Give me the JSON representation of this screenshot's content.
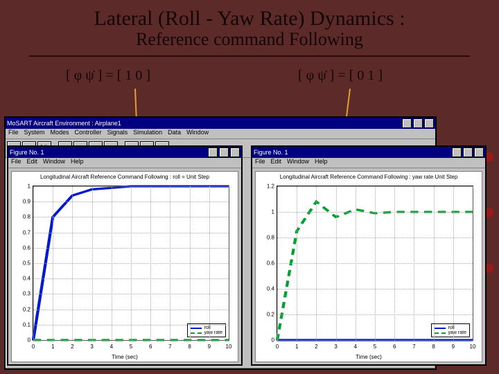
{
  "title": {
    "main": "Lateral (Roll - Yaw Rate) Dynamics :",
    "sub": "Reference command Following"
  },
  "equations": {
    "left": "[ φ  ψ̇ ]  =  [ 1  0 ]",
    "right": "[ φ  ψ̇ ]  =  [ 0  1 ]"
  },
  "sim_window": {
    "title": "MoSART Aircraft Environment : Airplane1",
    "menus": [
      "File",
      "System",
      "Modes",
      "Controller",
      "Signals",
      "Simulation",
      "Data",
      "Window"
    ],
    "tool_icons": [
      "new-icon",
      "open-icon",
      "save-icon",
      "run-icon",
      "pause-icon",
      "stop-icon",
      "step-icon",
      "plot-icon",
      "scope-icon",
      "config-icon"
    ]
  },
  "fig_left": {
    "title": "Figure No. 1",
    "menus": [
      "File",
      "Edit",
      "Window",
      "Help"
    ],
    "plot_title": "Longitudinal Aircraft Reference Command Following : roll = Unit Step",
    "xlabel": "Time (sec)",
    "legend": {
      "s1": "roll",
      "s2": "yaw rate"
    }
  },
  "fig_right": {
    "title": "Figure No. 1",
    "menus": [
      "File",
      "Edit",
      "Window",
      "Help"
    ],
    "plot_title": "Longitudinal Aircraft Reference Command Following : yaw rate  Unit Step",
    "xlabel": "Time (sec)",
    "legend": {
      "s1": "roll",
      "s2": "yaw rate"
    }
  },
  "chart_data": [
    {
      "type": "line",
      "title": "Longitudinal Aircraft Reference Command Following : roll = Unit Step",
      "xlabel": "Time (sec)",
      "ylabel": "",
      "xlim": [
        0,
        10
      ],
      "ylim": [
        0,
        1
      ],
      "grid": true,
      "legend_position": "bottom-right",
      "x": [
        0,
        1,
        2,
        3,
        4,
        5,
        6,
        7,
        8,
        9,
        10
      ],
      "series": [
        {
          "name": "roll",
          "color": "#0018d0",
          "dash": "solid",
          "values": [
            0.0,
            0.8,
            0.94,
            0.98,
            0.99,
            1.0,
            1.0,
            1.0,
            1.0,
            1.0,
            1.0
          ]
        },
        {
          "name": "yaw rate",
          "color": "#00a030",
          "dash": "dash",
          "values": [
            0.0,
            0.0,
            0.0,
            0.0,
            0.0,
            0.0,
            0.0,
            0.0,
            0.0,
            0.0,
            0.0
          ]
        }
      ],
      "xticks": [
        0,
        1,
        2,
        3,
        4,
        5,
        6,
        7,
        8,
        9,
        10
      ],
      "yticks": [
        0,
        0.1,
        0.2,
        0.3,
        0.4,
        0.5,
        0.6,
        0.7,
        0.8,
        0.9,
        1
      ]
    },
    {
      "type": "line",
      "title": "Longitudinal Aircraft Reference Command Following : yaw rate  Unit Step",
      "xlabel": "Time (sec)",
      "ylabel": "",
      "xlim": [
        0,
        10
      ],
      "ylim": [
        0,
        1.2
      ],
      "grid": true,
      "legend_position": "bottom-right",
      "x": [
        0,
        1,
        2,
        3,
        4,
        5,
        6,
        7,
        8,
        9,
        10
      ],
      "series": [
        {
          "name": "roll",
          "color": "#0018d0",
          "dash": "solid",
          "values": [
            0.0,
            0.0,
            0.0,
            0.0,
            0.0,
            0.0,
            0.0,
            0.0,
            0.0,
            0.0,
            0.0
          ]
        },
        {
          "name": "yaw rate",
          "color": "#00a030",
          "dash": "dash",
          "values": [
            0.0,
            0.85,
            1.08,
            0.96,
            1.02,
            0.99,
            1.0,
            1.0,
            1.0,
            1.0,
            1.0
          ]
        }
      ],
      "xticks": [
        0,
        1,
        2,
        3,
        4,
        5,
        6,
        7,
        8,
        9,
        10
      ],
      "yticks": [
        0,
        0.2,
        0.4,
        0.6,
        0.8,
        1,
        1.2
      ]
    }
  ]
}
